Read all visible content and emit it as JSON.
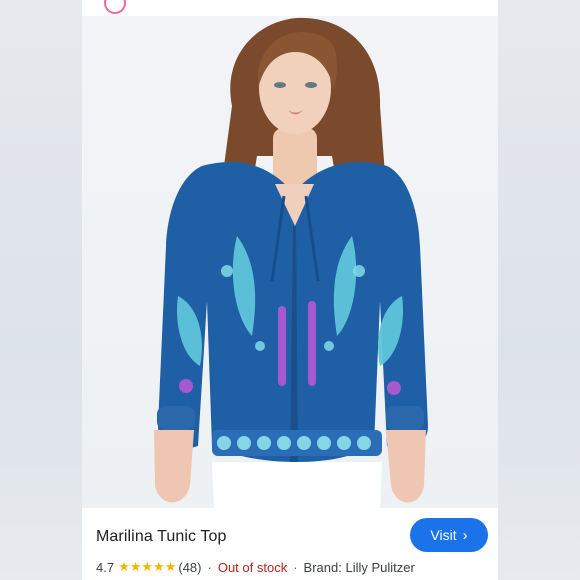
{
  "product": {
    "title": "Marilina Tunic Top",
    "visit_label": "Visit",
    "rating": "4.7",
    "stars": "★★★★★",
    "review_count": "(48)",
    "stock_status": "Out of stock",
    "brand": "Brand: Lilly Pulitzer"
  },
  "colors": {
    "accent": "#1a73e8",
    "stars": "#f4b400",
    "stock": "#b3261e",
    "garment": "#1e5fa6"
  },
  "icons": {
    "visit_chevron": "chevron-right-icon",
    "site_logo": "site-logo-icon"
  }
}
